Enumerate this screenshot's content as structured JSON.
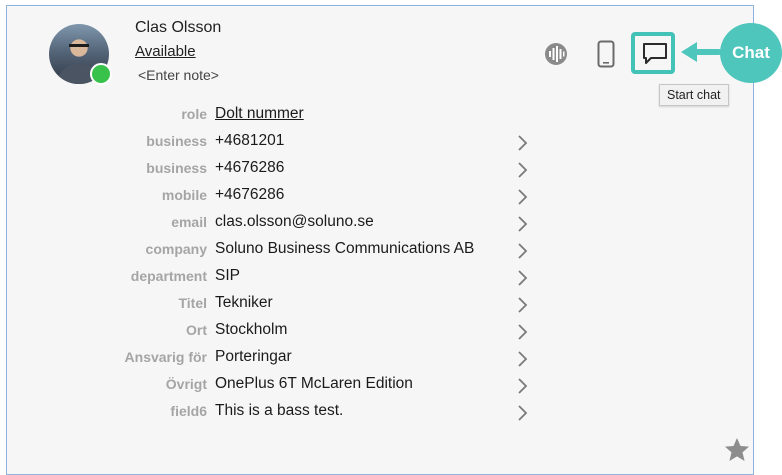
{
  "contact": {
    "name": "Clas Olsson",
    "status": "Available",
    "note_placeholder": "<Enter note>"
  },
  "actions": {
    "voice_icon": "voice-waveform-icon",
    "mobile_icon": "mobile-phone-icon",
    "chat_icon": "chat-bubble-icon",
    "tooltip": "Start chat",
    "callout_label": "Chat",
    "callout_color": "#4fc6bb"
  },
  "details": [
    {
      "label": "role",
      "value": "Dolt nummer",
      "link": true,
      "chevron": false
    },
    {
      "label": "business",
      "value": "+4681201",
      "chevron": true
    },
    {
      "label": "business",
      "value": "+4676286",
      "chevron": true
    },
    {
      "label": "mobile",
      "value": "+4676286",
      "chevron": true
    },
    {
      "label": "email",
      "value": "clas.olsson@soluno.se",
      "chevron": true
    },
    {
      "label": "company",
      "value": "Soluno Business Communications AB",
      "chevron": true
    },
    {
      "label": "department",
      "value": "SIP",
      "chevron": true
    },
    {
      "label": "Titel",
      "value": "Tekniker",
      "chevron": true
    },
    {
      "label": "Ort",
      "value": "Stockholm",
      "chevron": true
    },
    {
      "label": "Ansvarig för",
      "value": "Porteringar",
      "chevron": true
    },
    {
      "label": "Övrigt",
      "value": "OnePlus 6T McLaren Edition",
      "chevron": true
    },
    {
      "label": "field6",
      "value": "This is a bass test.",
      "chevron": true
    }
  ],
  "colors": {
    "card_border": "#8fb2de",
    "presence": "#39c24b",
    "highlight": "#43c2b8"
  }
}
